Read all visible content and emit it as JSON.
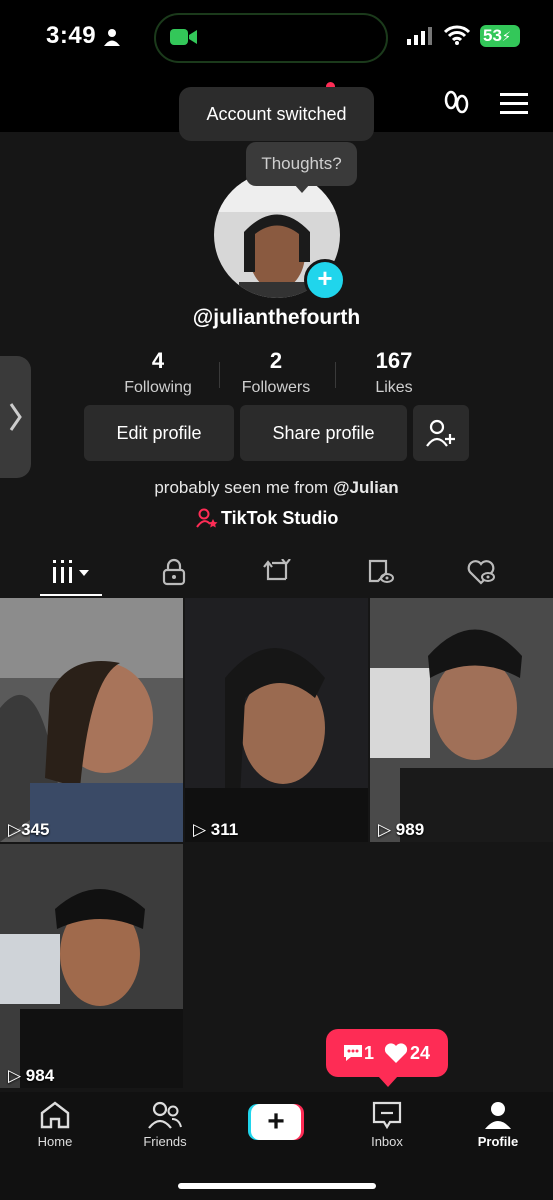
{
  "status": {
    "time": "3:49",
    "battery": "53"
  },
  "toast": "Account switched",
  "bubble": "Thoughts?",
  "profile": {
    "handle": "@julianthefourth",
    "stats": [
      {
        "num": "4",
        "label": "Following"
      },
      {
        "num": "2",
        "label": "Followers"
      },
      {
        "num": "167",
        "label": "Likes"
      }
    ],
    "edit_label": "Edit profile",
    "share_label": "Share profile",
    "bio_prefix": "probably seen me from",
    "bio_mention": "@Julian",
    "studio": "TikTok Studio"
  },
  "videos": [
    {
      "views": "345"
    },
    {
      "views": "311"
    },
    {
      "views": "989"
    },
    {
      "views": "984"
    }
  ],
  "notification": {
    "comments": "1",
    "likes": "24"
  },
  "nav": [
    {
      "label": "Home"
    },
    {
      "label": "Friends"
    },
    {
      "label": ""
    },
    {
      "label": "Inbox"
    },
    {
      "label": "Profile"
    }
  ],
  "colors": {
    "accent": "#fe2c55",
    "cyan": "#20d5ec",
    "battery": "#33c759"
  }
}
